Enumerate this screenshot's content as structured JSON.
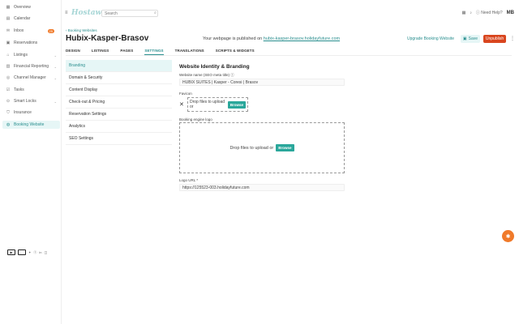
{
  "sidebar": {
    "items": [
      {
        "label": "Overview",
        "icon": "grid-icon"
      },
      {
        "label": "Calendar",
        "icon": "calendar-icon"
      },
      {
        "label": "Inbox",
        "icon": "inbox-icon",
        "badge": "25"
      },
      {
        "label": "Reservations",
        "icon": "bookmark-icon"
      },
      {
        "label": "Listings",
        "icon": "home-icon"
      },
      {
        "label": "Financial Reporting",
        "icon": "chart-icon"
      },
      {
        "label": "Channel Manager",
        "icon": "channel-icon"
      },
      {
        "label": "Tasks",
        "icon": "tasks-icon"
      },
      {
        "label": "Smart Locks",
        "icon": "lock-icon"
      },
      {
        "label": "Insurance",
        "icon": "shield-icon"
      },
      {
        "label": "Booking Website",
        "icon": "globe-icon"
      }
    ]
  },
  "topbar": {
    "logo": "Hostaway",
    "search_placeholder": "Search",
    "help": "Need Help?",
    "avatar": "MB"
  },
  "header": {
    "breadcrumb": "Booking Websites",
    "title": "Hubix-Kasper-Brasov",
    "published_prefix": "Your webpage is published on",
    "published_url": "hubix-kasper-brasov.holidayfuture.com",
    "upgrade": "Upgrade Booking Website",
    "save": "Save",
    "unpublish": "Unpublish"
  },
  "tabs": [
    "DESIGN",
    "LISTINGS",
    "PAGES",
    "SETTINGS",
    "TRANSLATIONS",
    "SCRIPTS & WIDGETS"
  ],
  "active_tab": "SETTINGS",
  "settings_nav": [
    "Branding",
    "Domain & Security",
    "Content Display",
    "Check-out & Pricing",
    "Reservation Settings",
    "Analytics",
    "SEO Settings"
  ],
  "branding": {
    "section_title": "Website Identity & Branding",
    "website_name_label": "Website name (SEO meta title)",
    "website_name_value": "HUBIX SUITES | Kasper - Coresi | Brasov",
    "favicon_label": "Favicon",
    "drop_text": "Drop files to upload or",
    "browse": "Browse",
    "logo_label": "Booking engine logo",
    "logo_url_label": "Logo URL *",
    "logo_url_value": "https://125523-003.holidayfuture.com"
  },
  "colors": {
    "accent": "#2a8f8f",
    "unpublish": "#d9461f",
    "fab": "#f07a2a"
  }
}
